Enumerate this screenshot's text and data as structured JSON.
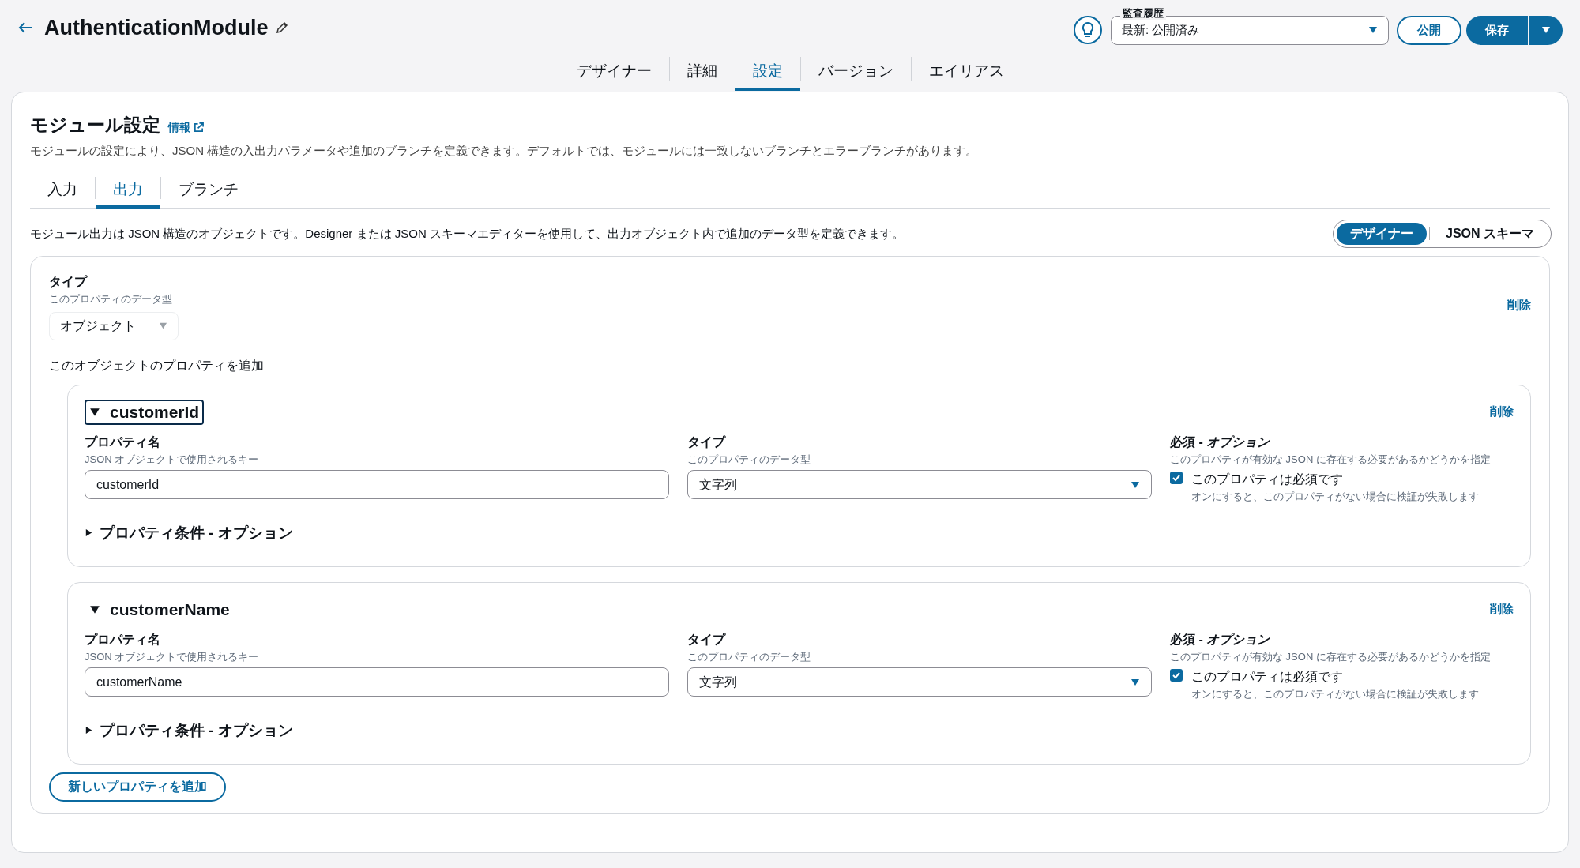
{
  "title": "AuthenticationModule",
  "audit": {
    "label": "監査履歴",
    "value": "最新: 公開済み"
  },
  "publish_button": "公開",
  "save_button": "保存",
  "tabs": [
    {
      "label": "デザイナー",
      "selected": false
    },
    {
      "label": "詳細",
      "selected": false
    },
    {
      "label": "設定",
      "selected": true
    },
    {
      "label": "バージョン",
      "selected": false
    },
    {
      "label": "エイリアス",
      "selected": false
    }
  ],
  "settings": {
    "heading": "モジュール設定",
    "info_link": "情報",
    "description": "モジュールの設定により、JSON 構造の入出力パラメータや追加のブランチを定義できます。デフォルトでは、モジュールには一致しないブランチとエラーブランチがあります。"
  },
  "sub_tabs": [
    {
      "label": "入力",
      "selected": false
    },
    {
      "label": "出力",
      "selected": true
    },
    {
      "label": "ブランチ",
      "selected": false
    }
  ],
  "output_description": "モジュール出力は JSON 構造のオブジェクトです。Designer または JSON スキーマエディターを使用して、出力オブジェクト内で追加のデータ型を定義できます。",
  "mode_toggle": [
    {
      "label": "デザイナー",
      "selected": true
    },
    {
      "label": "JSON スキーマ",
      "selected": false
    }
  ],
  "root": {
    "type_label": "タイプ",
    "type_hint": "このプロパティのデータ型",
    "type_value": "オブジェクト",
    "delete": "削除",
    "add_properties_label": "このオブジェクトのプロパティを追加"
  },
  "properties": [
    {
      "name": "customerId",
      "expanded": true,
      "focused": true,
      "delete": "削除",
      "name_label": "プロパティ名",
      "name_hint": "JSON オブジェクトで使用されるキー",
      "name_value": "customerId",
      "type_label": "タイプ",
      "type_hint": "このプロパティのデータ型",
      "type_value": "文字列",
      "required_label": "必須 - *オプション*",
      "required_hint": "このプロパティが有効な JSON に存在する必要があるかどうかを指定",
      "required_checkbox": "このプロパティは必須です",
      "required_checked": true,
      "required_note": "オンにすると、このプロパティがない場合に検証が失敗します",
      "conditions": "プロパティ条件 - オプション",
      "conditions_expanded": false
    },
    {
      "name": "customerName",
      "expanded": true,
      "focused": false,
      "delete": "削除",
      "name_label": "プロパティ名",
      "name_hint": "JSON オブジェクトで使用されるキー",
      "name_value": "customerName",
      "type_label": "タイプ",
      "type_hint": "このプロパティのデータ型",
      "type_value": "文字列",
      "required_label": "必須 - *オプション*",
      "required_hint": "このプロパティが有効な JSON に存在する必要があるかどうかを指定",
      "required_checkbox": "このプロパティは必須です",
      "required_checked": true,
      "required_note": "オンにすると、このプロパティがない場合に検証が失敗します",
      "conditions": "プロパティ条件 - オプション",
      "conditions_expanded": false
    }
  ],
  "add_button": "新しいプロパティを追加"
}
